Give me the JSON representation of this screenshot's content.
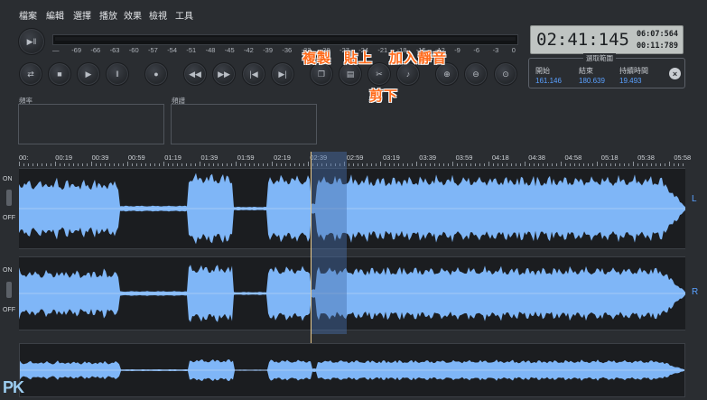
{
  "menu": [
    "檔案",
    "編輯",
    "選擇",
    "播放",
    "效果",
    "檢視",
    "工具"
  ],
  "meter_ticks": [
    "—",
    "-69",
    "-66",
    "-63",
    "-60",
    "-57",
    "-54",
    "-51",
    "-48",
    "-45",
    "-42",
    "-39",
    "-36",
    "-33",
    "-30",
    "-27",
    "-24",
    "-21",
    "-18",
    "-15",
    "-12",
    "-9",
    "-6",
    "-3",
    "0"
  ],
  "time": {
    "current": "02:41:145",
    "total": "06:07:564",
    "selection": "00:11:789"
  },
  "selection": {
    "title": "選取範圍",
    "start_label": "開始",
    "end_label": "結束",
    "duration_label": "持續時間",
    "start": "161.146",
    "end": "180.639",
    "duration": "19.493",
    "close_icon": "close-icon"
  },
  "annotations": {
    "copy": "複製",
    "paste": "貼上",
    "insert_silence": "加入靜音",
    "cut": "剪下"
  },
  "panels": {
    "frequency": "頻率",
    "spectrum": "頻譜"
  },
  "ruler": [
    "00:",
    "00:19",
    "00:39",
    "00:59",
    "01:19",
    "01:39",
    "01:59",
    "02:19",
    "02:39",
    "02:59",
    "03:19",
    "03:39",
    "03:59",
    "04:18",
    "04:38",
    "04:58",
    "05:18",
    "05:38",
    "05:58"
  ],
  "tracks": {
    "left_label": "L",
    "right_label": "R",
    "on": "ON",
    "off": "OFF"
  },
  "waveform_color": "#7fb6f7",
  "playhead_color": "#e9c98a",
  "selection_color": "#3a5a86",
  "logo": "PK"
}
